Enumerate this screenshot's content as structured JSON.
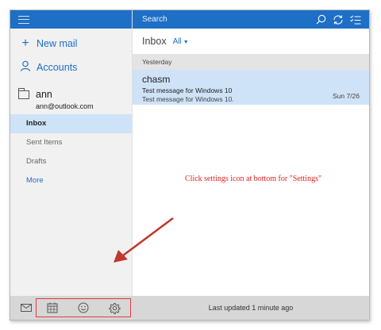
{
  "sidebar": {
    "new_mail_label": "New mail",
    "accounts_label": "Accounts",
    "account": {
      "name": "ann",
      "email": "ann@outlook.com"
    },
    "folders": [
      {
        "label": "Inbox",
        "selected": true
      },
      {
        "label": "Sent Items",
        "selected": false
      },
      {
        "label": "Drafts",
        "selected": false
      }
    ],
    "more_label": "More",
    "bottom_icons": [
      "mail-icon",
      "calendar-icon",
      "feedback-smiley-icon",
      "settings-gear-icon"
    ]
  },
  "topbar": {
    "search_placeholder": "Search",
    "icons": [
      "search-icon",
      "sync-icon",
      "select-mode-icon"
    ]
  },
  "inbox": {
    "title": "Inbox",
    "filter_label": "All",
    "group_label": "Yesterday",
    "messages": [
      {
        "sender": "chasm",
        "subject": "Test message for Windows 10",
        "preview": "Test message for Windows 10.",
        "date": "Sun 7/26"
      }
    ]
  },
  "annotation_text": "Click settings icon at bottom for \"Settings\"",
  "status_text": "Last updated 1 minute ago",
  "colors": {
    "accent": "#1e6fc6",
    "selection": "#cfe3f8",
    "annotation": "#e02020"
  }
}
